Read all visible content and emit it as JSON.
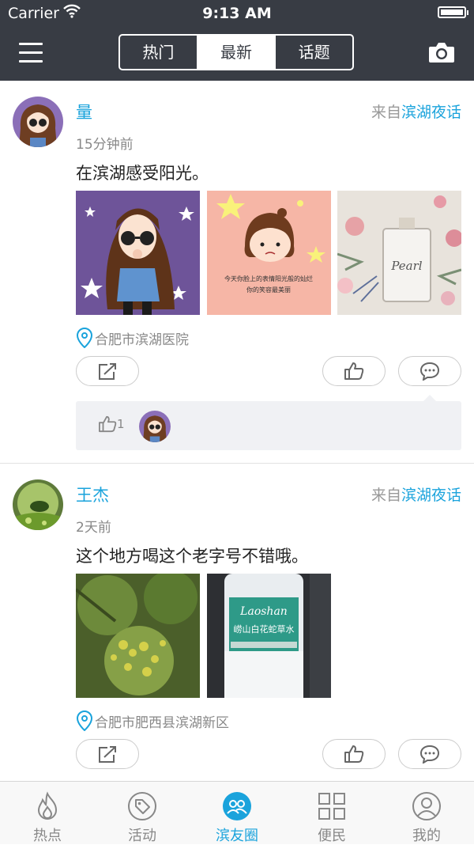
{
  "status_bar": {
    "carrier": "Carrier",
    "time": "9:13 AM"
  },
  "header": {
    "tabs": [
      {
        "label": "热门",
        "active": false
      },
      {
        "label": "最新",
        "active": true
      },
      {
        "label": "话题",
        "active": false
      }
    ],
    "menu_icon": "hamburger-icon",
    "camera_icon": "camera-icon"
  },
  "posts": [
    {
      "username": "量",
      "source_prefix": "来自",
      "source_name": "滨湖夜话",
      "time": "15分钟前",
      "text": "在滨湖感受阳光。",
      "image_count": 3,
      "image2_caption_line1": "今天你脸上的表情阳光般的灿烂",
      "image2_caption_line2": "你的笑容最美丽",
      "image3_text": "Pearl",
      "location": "合肥市滨湖医院",
      "like_count": "1"
    },
    {
      "username": "王杰",
      "source_prefix": "来自",
      "source_name": "滨湖夜话",
      "time": "2天前",
      "text": "这个地方喝这个老字号不错哦。",
      "image_count": 2,
      "image2_brand": "Laoshan",
      "image2_label": "崂山白花蛇草水",
      "location": "合肥市肥西县滨湖新区"
    }
  ],
  "tabbar": [
    {
      "label": "热点",
      "icon": "flame-icon",
      "active": false
    },
    {
      "label": "活动",
      "icon": "tag-icon",
      "active": false
    },
    {
      "label": "滨友圈",
      "icon": "friends-circle-icon",
      "active": true
    },
    {
      "label": "便民",
      "icon": "grid-icon",
      "active": false
    },
    {
      "label": "我的",
      "icon": "profile-icon",
      "active": false
    }
  ],
  "colors": {
    "accent": "#1aa3dc",
    "header_bg": "#383c44",
    "meta_text": "#888888"
  }
}
